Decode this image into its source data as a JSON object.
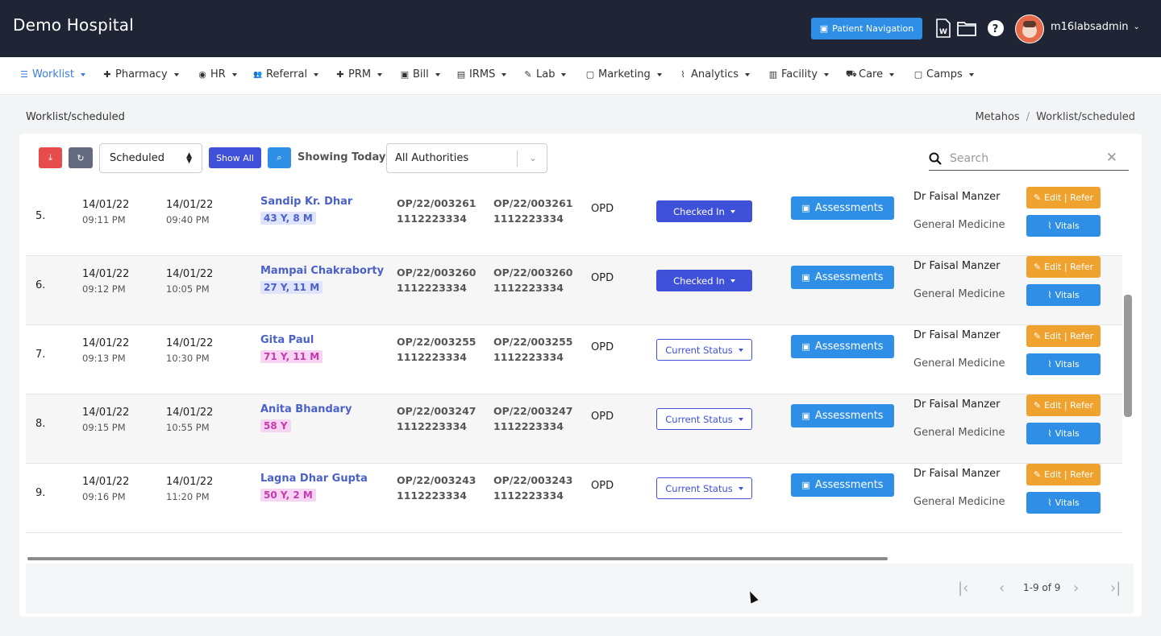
{
  "header": {
    "brand": "Demo Hospital",
    "patient_navigation": "Patient Navigation",
    "username": "m16labsadmin"
  },
  "nav": [
    {
      "label": "Worklist",
      "icon": "list-icon",
      "glyph": "☰"
    },
    {
      "label": "Pharmacy",
      "icon": "plus-icon",
      "glyph": "✚"
    },
    {
      "label": "HR",
      "icon": "user-circle-icon",
      "glyph": "◉"
    },
    {
      "label": "Referral",
      "icon": "users-icon",
      "glyph": "👥"
    },
    {
      "label": "PRM",
      "icon": "plus-icon",
      "glyph": "✚"
    },
    {
      "label": "Bill",
      "icon": "money-icon",
      "glyph": "▣"
    },
    {
      "label": "IRMS",
      "icon": "table-icon",
      "glyph": "▤"
    },
    {
      "label": "Lab",
      "icon": "pencil-icon",
      "glyph": "✎"
    },
    {
      "label": "Marketing",
      "icon": "briefcase-icon",
      "glyph": "▢"
    },
    {
      "label": "Analytics",
      "icon": "chart-line-icon",
      "glyph": "⌇"
    },
    {
      "label": "Facility",
      "icon": "building-icon",
      "glyph": "▥"
    },
    {
      "label": "Care",
      "icon": "ambulance-icon",
      "glyph": "⛟"
    },
    {
      "label": "Camps",
      "icon": "briefcase-icon",
      "glyph": "▢"
    }
  ],
  "page": {
    "title": "Worklist/scheduled",
    "breadcrumb": [
      "Metahos",
      "Worklist/scheduled"
    ]
  },
  "toolbar": {
    "schedule_value": "Scheduled",
    "show_all": "Show All",
    "showing": "Showing Today",
    "authorities": "All Authorities",
    "search_placeholder": "Search"
  },
  "rows": [
    {
      "index": "5.",
      "date1": "14/01/22",
      "time1": "09:11 PM",
      "date2": "14/01/22",
      "time2": "09:40 PM",
      "name": "Sandip Kr. Dhar",
      "age": "43 Y, 8 M",
      "age_style": "blue",
      "op1": "OP/22/003261",
      "ph1": "1112223334",
      "op2": "OP/22/003261",
      "ph2": "1112223334",
      "type": "OPD",
      "status": "Checked In",
      "status_style": "checked",
      "assess": "Assessments",
      "doctor": "Dr Faisal Manzer",
      "dept": "General Medicine",
      "edit": "Edit | Refer",
      "vitals": "Vitals"
    },
    {
      "index": "6.",
      "date1": "14/01/22",
      "time1": "09:12 PM",
      "date2": "14/01/22",
      "time2": "10:05 PM",
      "name": "Mampai Chakraborty",
      "age": "27 Y, 11 M",
      "age_style": "blue",
      "op1": "OP/22/003260",
      "ph1": "1112223334",
      "op2": "OP/22/003260",
      "ph2": "1112223334",
      "type": "OPD",
      "status": "Checked In",
      "status_style": "checked",
      "assess": "Assessments",
      "doctor": "Dr Faisal Manzer",
      "dept": "General Medicine",
      "edit": "Edit | Refer",
      "vitals": "Vitals"
    },
    {
      "index": "7.",
      "date1": "14/01/22",
      "time1": "09:13 PM",
      "date2": "14/01/22",
      "time2": "10:30 PM",
      "name": "Gita Paul",
      "age": "71 Y, 11 M",
      "age_style": "pink",
      "op1": "OP/22/003255",
      "ph1": "1112223334",
      "op2": "OP/22/003255",
      "ph2": "1112223334",
      "type": "OPD",
      "status": "Current Status",
      "status_style": "current",
      "assess": "Assessments",
      "doctor": "Dr Faisal Manzer",
      "dept": "General Medicine",
      "edit": "Edit | Refer",
      "vitals": "Vitals"
    },
    {
      "index": "8.",
      "date1": "14/01/22",
      "time1": "09:15 PM",
      "date2": "14/01/22",
      "time2": "10:55 PM",
      "name": "Anita Bhandary",
      "age": "58 Y",
      "age_style": "pink",
      "op1": "OP/22/003247",
      "ph1": "1112223334",
      "op2": "OP/22/003247",
      "ph2": "1112223334",
      "type": "OPD",
      "status": "Current Status",
      "status_style": "current",
      "assess": "Assessments",
      "doctor": "Dr Faisal Manzer",
      "dept": "General Medicine",
      "edit": "Edit | Refer",
      "vitals": "Vitals"
    },
    {
      "index": "9.",
      "date1": "14/01/22",
      "time1": "09:16 PM",
      "date2": "14/01/22",
      "time2": "11:20 PM",
      "name": "Lagna Dhar Gupta",
      "age": "50 Y, 2 M",
      "age_style": "pink",
      "op1": "OP/22/003243",
      "ph1": "1112223334",
      "op2": "OP/22/003243",
      "ph2": "1112223334",
      "type": "OPD",
      "status": "Current Status",
      "status_style": "current",
      "assess": "Assessments",
      "doctor": "Dr Faisal Manzer",
      "dept": "General Medicine",
      "edit": "Edit | Refer",
      "vitals": "Vitals"
    }
  ],
  "pagination": {
    "range": "1-9 of 9"
  },
  "colors": {
    "header_bg": "#1f2535",
    "primary": "#2f8fe6",
    "indigo": "#3f51d8",
    "warning": "#f0a22f",
    "danger": "#e74c4c",
    "age_blue_bg": "#dfe3fb",
    "age_pink_bg": "#f7d4f1"
  }
}
